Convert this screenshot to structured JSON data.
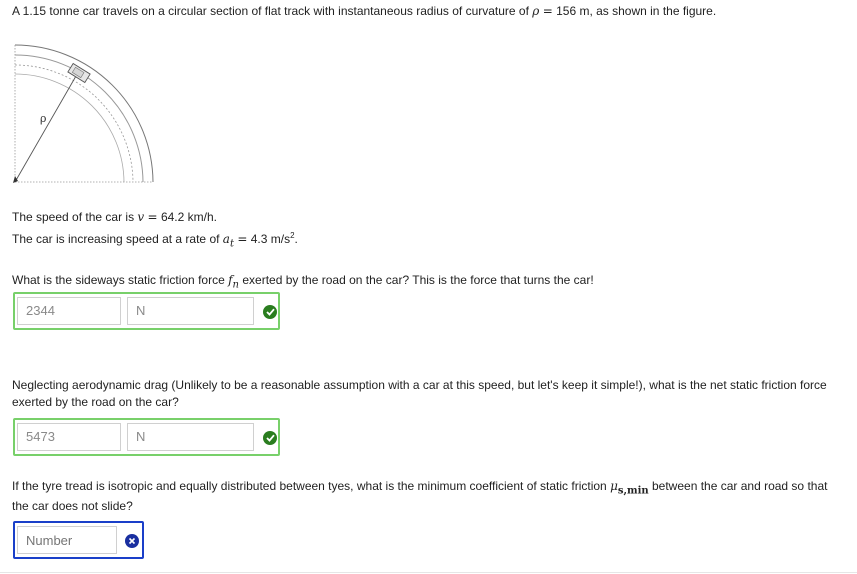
{
  "intro": {
    "prefix": "A 1.15 tonne car travels on a circular section of flat track with instantaneous radius of curvature of",
    "symbol": "ρ",
    "equals": "=",
    "value": "156 m, as shown in the figure."
  },
  "figure": {
    "radius_label": "ρ"
  },
  "given": {
    "speed_prefix": "The speed of the car is",
    "speed_symbol": "v",
    "speed_equals": "=",
    "speed_value": "64.2 km/h.",
    "accel_prefix": "The car is increasing speed at a rate of",
    "accel_symbol": "a",
    "accel_sub": "t",
    "accel_equals": "=",
    "accel_value": "4.3 m/s",
    "accel_exp": "2",
    "accel_end": "."
  },
  "q1": {
    "prefix": "What is the sideways static friction force",
    "symbol": "f",
    "sub": "n",
    "suffix": "exerted by the road on the car? This is the force that turns the car!",
    "answer": "2344",
    "unit": "N",
    "status": "correct"
  },
  "q2": {
    "line1": "Neglecting aerodynamic drag (Unlikely to be a reasonable assumption with a car at this speed, but let's keep it simple!), what is the net static friction force",
    "line2": "exerted by the road on the car?",
    "answer": "5473",
    "unit": "N",
    "status": "correct"
  },
  "q3": {
    "prefix": "If the tyre tread is isotropic and equally distributed between tyes, what is the minimum coefficient of static friction",
    "symbol": "μ",
    "sub": "s,min",
    "suffix": "between the car and road so that",
    "line2": "the car does not slide?",
    "answer": "",
    "placeholder": "Number",
    "status": "incorrect"
  },
  "colors": {
    "correct": "#2a7d1f",
    "incorrect": "#1a2fa0",
    "correct_border": "#78d06a",
    "active_border": "#1a3fc9"
  }
}
